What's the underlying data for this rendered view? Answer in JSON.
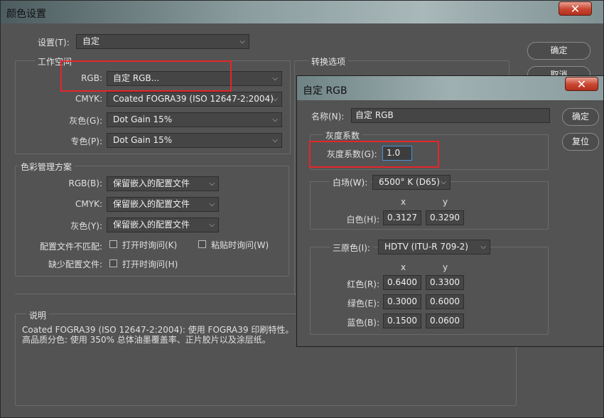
{
  "main": {
    "title": "颜色设置",
    "settings": {
      "label": "设置(T):",
      "value": "自定"
    },
    "workspace": {
      "title": "工作空间",
      "rgb_label": "RGB:",
      "rgb_value": "自定 RGB...",
      "cmyk_label": "CMYK:",
      "cmyk_value": "Coated FOGRA39 (ISO 12647-2:2004)",
      "gray_label": "灰色(G):",
      "gray_value": "Dot Gain 15%",
      "spot_label": "专色(P):",
      "spot_value": "Dot Gain 15%"
    },
    "policies": {
      "title": "色彩管理方案",
      "rgb_label": "RGB(B):",
      "rgb_value": "保留嵌入的配置文件",
      "cmyk_label": "CMYK:",
      "cmyk_value": "保留嵌入的配置文件",
      "gray_label": "灰色(Y):",
      "gray_value": "保留嵌入的配置文件",
      "mismatch_label": "配置文件不匹配:",
      "mismatch_open": "打开时询问(K)",
      "mismatch_paste": "粘贴时询问(W)",
      "missing_label": "缺少配置文件:",
      "missing_open": "打开时询问(H)"
    },
    "conversion": {
      "title": "转换选项"
    },
    "description": {
      "title": "说明",
      "line1": "Coated FOGRA39 (ISO 12647-2:2004): 使用 FOGRA39 印刷特性。 该",
      "line2": "高品质分色: 使用 350% 总体油墨覆盖率、正片胶片以及涂层纸。"
    },
    "buttons": {
      "ok": "确定",
      "cancel": "取消"
    }
  },
  "custom_rgb": {
    "title": "自定 RGB",
    "name_label": "名称(N):",
    "name_value": "自定 RGB",
    "ok": "确定",
    "reset": "复位",
    "gamma": {
      "title": "灰度系数",
      "label": "灰度系数(G):",
      "value": "1.0"
    },
    "white": {
      "label": "白场(W):",
      "value": "6500° K (D65)",
      "x_header": "x",
      "y_header": "y",
      "row_label": "白色(H):",
      "x": "0.3127",
      "y": "0.3290"
    },
    "primaries": {
      "label": "三原色(I):",
      "value": "HDTV (ITU-R 709-2)",
      "x_header": "x",
      "y_header": "y",
      "rows": [
        {
          "label": "红色(R):",
          "x": "0.6400",
          "y": "0.3300"
        },
        {
          "label": "绿色(E):",
          "x": "0.3000",
          "y": "0.6000"
        },
        {
          "label": "蓝色(B):",
          "x": "0.1500",
          "y": "0.0600"
        }
      ]
    }
  }
}
